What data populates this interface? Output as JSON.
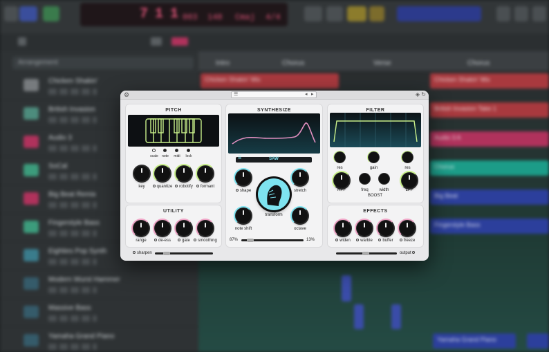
{
  "background": {
    "lcd": {
      "bar": "7",
      "beat": "1",
      "sub": "1",
      "div": "003",
      "tempo": "148",
      "key": "Cmaj",
      "sig": "4/4"
    },
    "arrangement_label": "Arrangement",
    "tracks": [
      {
        "name": "Chicken Shakin'",
        "color": "#777b7e"
      },
      {
        "name": "British Invasion",
        "color": "#4d8c7d"
      },
      {
        "name": "Audio 3",
        "color": "#b0325c"
      },
      {
        "name": "SoCal",
        "color": "#3c9c7c"
      },
      {
        "name": "Big Beat Remix",
        "color": "#b0325c"
      },
      {
        "name": "Fingerstyle Bass",
        "color": "#3c9c7c"
      },
      {
        "name": "Eighties Pop Synth",
        "color": "#3a7c8c"
      },
      {
        "name": "Modern Wurst Hammer",
        "color": "#355b6a"
      },
      {
        "name": "Massive Bass",
        "color": "#355b6a"
      },
      {
        "name": "Yamaha Grand Piano",
        "color": "#355b6a"
      }
    ],
    "sections": [
      "Intro",
      "Chorus",
      "Verse",
      "Chorus"
    ],
    "clips": [
      {
        "label": "Chicken Shakin' Mix",
        "color": "#a8393e"
      },
      {
        "label": "British Invasion Take 1",
        "color": "#a8393e"
      },
      {
        "label": "Audio 3 A",
        "color": "#b0325c"
      },
      {
        "label": "Chorus",
        "color": "#1c9c88"
      },
      {
        "label": "Big Beat",
        "color": "#2c3f9c"
      },
      {
        "label": "Fingerstyle Bass",
        "color": "#2c3f9c"
      },
      {
        "label": "Yamaha Grand Piano",
        "color": "#2c3f9c"
      }
    ]
  },
  "plugin": {
    "pitch": {
      "title": "PITCH",
      "options": [
        "scale",
        "note",
        "midi",
        "lock"
      ],
      "knobs": [
        {
          "label": "key",
          "ring": "none"
        },
        {
          "label": "quantize",
          "ring": "lime"
        },
        {
          "label": "robotify",
          "ring": "lime"
        },
        {
          "label": "formant",
          "ring": "lime"
        }
      ]
    },
    "synthesize": {
      "title": "SYNTHESIZE",
      "wave": "SAW",
      "knobs": [
        {
          "label": "shape",
          "ring": "cyan"
        },
        {
          "label": "stretch",
          "ring": "cyan"
        },
        {
          "label": "note shift",
          "ring": "cyan"
        },
        {
          "label": "octave",
          "ring": "cyan"
        }
      ],
      "center_label": "transform",
      "mix_left": "87%",
      "mix_right": "13%"
    },
    "filter": {
      "title": "FILTER",
      "small_knobs": [
        "res",
        "gain",
        "res"
      ],
      "knobs": [
        {
          "label": "HPF",
          "ring": "lime"
        },
        {
          "label": "freq",
          "ring": "none"
        },
        {
          "label": "width",
          "ring": "none"
        },
        {
          "label": "LPF",
          "ring": "lime"
        }
      ],
      "group_label": "BOOST"
    },
    "utility": {
      "title": "UTILITY",
      "knobs": [
        {
          "label": "range",
          "ring": "pink"
        },
        {
          "label": "de-ess",
          "ring": "pink"
        },
        {
          "label": "gate",
          "ring": "pink"
        },
        {
          "label": "smoothing",
          "ring": "pink"
        }
      ],
      "sharpen_label": "sharpen"
    },
    "effects": {
      "title": "EFFECTS",
      "knobs": [
        {
          "label": "widen",
          "ring": "pink"
        },
        {
          "label": "warble",
          "ring": "pink"
        },
        {
          "label": "buffer",
          "ring": "pink"
        },
        {
          "label": "freeze",
          "ring": "pink"
        }
      ],
      "output_label": "output"
    }
  }
}
